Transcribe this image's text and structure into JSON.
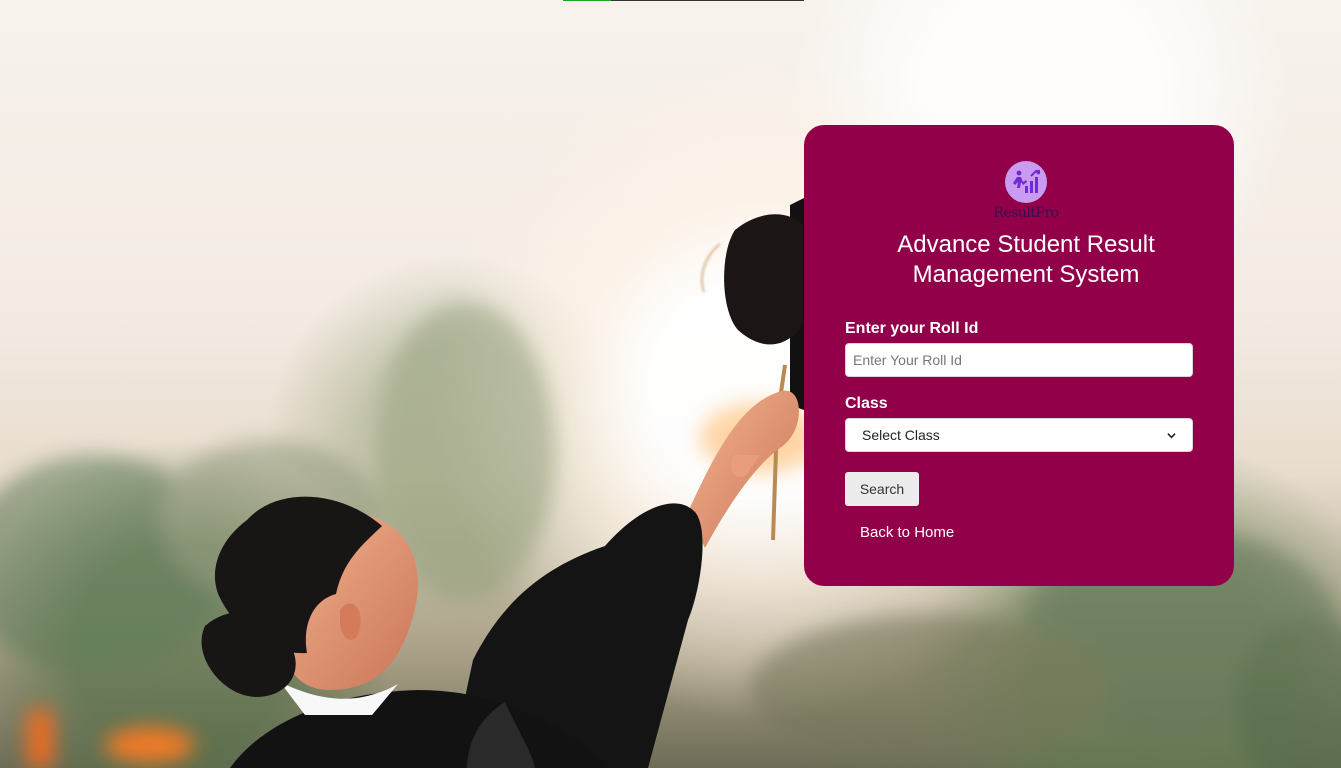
{
  "brand": {
    "logo_text": "ResultPro",
    "colors": {
      "card": "#93004a",
      "logo_circle": "#c99cf2",
      "logo_icon": "#6f2bd8",
      "progress": "#14a91d"
    }
  },
  "page": {
    "title": "Advance Student Result Management System",
    "progress_fraction": 0.2
  },
  "form": {
    "roll_label": "Enter your Roll Id",
    "roll_placeholder": "Enter Your Roll Id",
    "roll_value": "",
    "class_label": "Class",
    "class_selected": "Select Class",
    "search_button": "Search",
    "back_link": "Back to Home"
  },
  "icons": {
    "logo": "student-progress-icon",
    "select": "chevron-down-icon"
  }
}
